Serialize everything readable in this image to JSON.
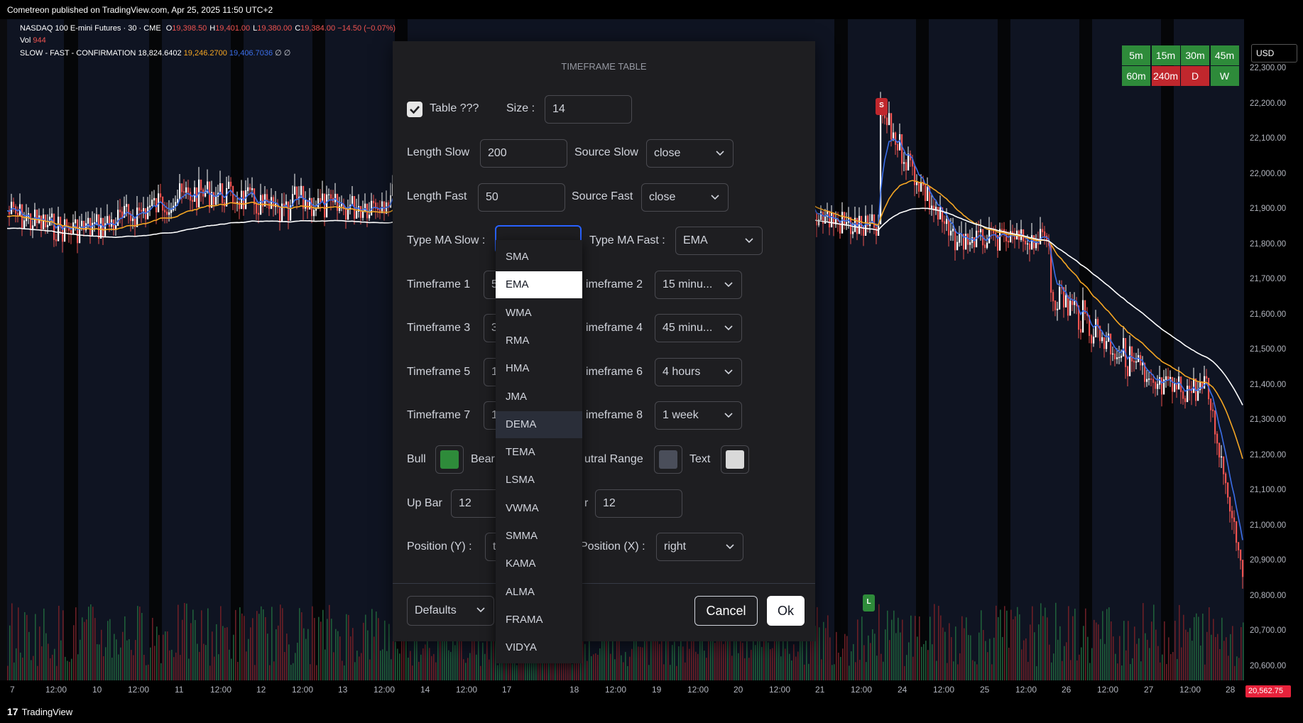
{
  "topbar": {
    "text": "Cometreon published on TradingView.com, Apr 25, 2025 11:50 UTC+2"
  },
  "legend": {
    "symbol": "NASDAQ 100 E-mini Futures · 30 · CME",
    "ohlc": [
      {
        "k": "O",
        "v": "19,398.50"
      },
      {
        "k": "H",
        "v": "19,401.00"
      },
      {
        "k": "L",
        "v": "19,380.00"
      },
      {
        "k": "C",
        "v": "19,384.00"
      }
    ],
    "change": "−14.50 (−0.07%)",
    "vol_label": "Vol",
    "vol_value": "944",
    "indicator_name": "SLOW - FAST - CONFIRMATION",
    "ind_v1": "18,824.6402",
    "ind_v2": "19,246.2700",
    "ind_v3": "19,406.7036",
    "ind_v4": "∅ ∅"
  },
  "timeframe_table": [
    {
      "label": "5m",
      "color": "#2e8b3a"
    },
    {
      "label": "15m",
      "color": "#2e8b3a"
    },
    {
      "label": "30m",
      "color": "#2e8b3a"
    },
    {
      "label": "45m",
      "color": "#2e8b3a"
    },
    {
      "label": "60m",
      "color": "#2e8b3a"
    },
    {
      "label": "240m",
      "color": "#c0272d"
    },
    {
      "label": "D",
      "color": "#c0272d"
    },
    {
      "label": "W",
      "color": "#2e8b3a"
    }
  ],
  "signals": {
    "sell": "S",
    "long": "L"
  },
  "yaxis": {
    "currency": "USD",
    "labels": [
      "22,300.00",
      "22,200.00",
      "22,100.00",
      "22,000.00",
      "21,900.00",
      "21,800.00",
      "21,700.00",
      "21,600.00",
      "21,500.00",
      "21,400.00",
      "21,300.00",
      "21,200.00",
      "21,100.00",
      "21,000.00",
      "20,900.00",
      "20,800.00",
      "20,700.00",
      "20,600.00"
    ],
    "last_price": "20,562.75"
  },
  "xaxis": {
    "labels": [
      "7",
      "12:00",
      "10",
      "12:00",
      "11",
      "12:00",
      "12",
      "12:00",
      "13",
      "12:00",
      "14",
      "12:00",
      "17",
      "18",
      "12:00",
      "19",
      "12:00",
      "20",
      "12:00",
      "21",
      "12:00",
      "24",
      "12:00",
      "25",
      "12:00",
      "26",
      "12:00",
      "27",
      "12:00",
      "28"
    ]
  },
  "footer": {
    "brand": "TradingView"
  },
  "dialog": {
    "title": "TIMEFRAME TABLE",
    "table_label": "Table ???",
    "table_checked": true,
    "size_label": "Size :",
    "size_value": "14",
    "length_slow_label": "Length Slow",
    "length_slow_value": "200",
    "source_slow_label": "Source Slow",
    "source_slow_value": "close",
    "length_fast_label": "Length Fast",
    "length_fast_value": "50",
    "source_fast_label": "Source Fast",
    "source_fast_value": "close",
    "type_ma_slow_label": "Type MA Slow :",
    "type_ma_fast_label": "Type MA Fast :",
    "type_ma_fast_value": "EMA",
    "tf1_label": "Timeframe 1",
    "tf1_value": "5",
    "tf2_label": "imeframe 2",
    "tf2_value": "15 minu...",
    "tf3_label": "Timeframe 3",
    "tf3_value": "3",
    "tf4_label": "imeframe 4",
    "tf4_value": "45 minu...",
    "tf5_label": "Timeframe 5",
    "tf5_value": "1",
    "tf6_label": "imeframe 6",
    "tf6_value": "4 hours",
    "tf7_label": "Timeframe 7",
    "tf7_value": "1",
    "tf8_label": "imeframe 8",
    "tf8_value": "1 week",
    "bull_label": "Bull",
    "bull_color": "#2e8b3a",
    "bear_label": "Bear",
    "neutral_label": "utral Range",
    "neutral_color": "#4a4e5a",
    "text_label": "Text",
    "text_color": "#d9d9d9",
    "up_bar_label": "Up Bar",
    "up_bar_value": "12",
    "down_bar_label": "r",
    "down_bar_value": "12",
    "pos_y_label": "Position (Y) :",
    "pos_y_value": "t",
    "pos_x_label": "Position (X) :",
    "pos_x_value": "right",
    "defaults_label": "Defaults",
    "cancel_label": "Cancel",
    "ok_label": "Ok"
  },
  "ma_dropdown": {
    "items": [
      "SMA",
      "EMA",
      "WMA",
      "RMA",
      "HMA",
      "JMA",
      "DEMA",
      "TEMA",
      "LSMA",
      "VWMA",
      "SMMA",
      "KAMA",
      "ALMA",
      "FRAMA",
      "VIDYA"
    ],
    "selected": "EMA",
    "hovered": "DEMA"
  },
  "colors": {
    "accent": "#2962ff",
    "bull": "#26a69a",
    "bear": "#ef5350",
    "fast_ma": "#f5a623",
    "slow_ma": "#ffffff",
    "confirm_ma": "#3b6ee8"
  }
}
